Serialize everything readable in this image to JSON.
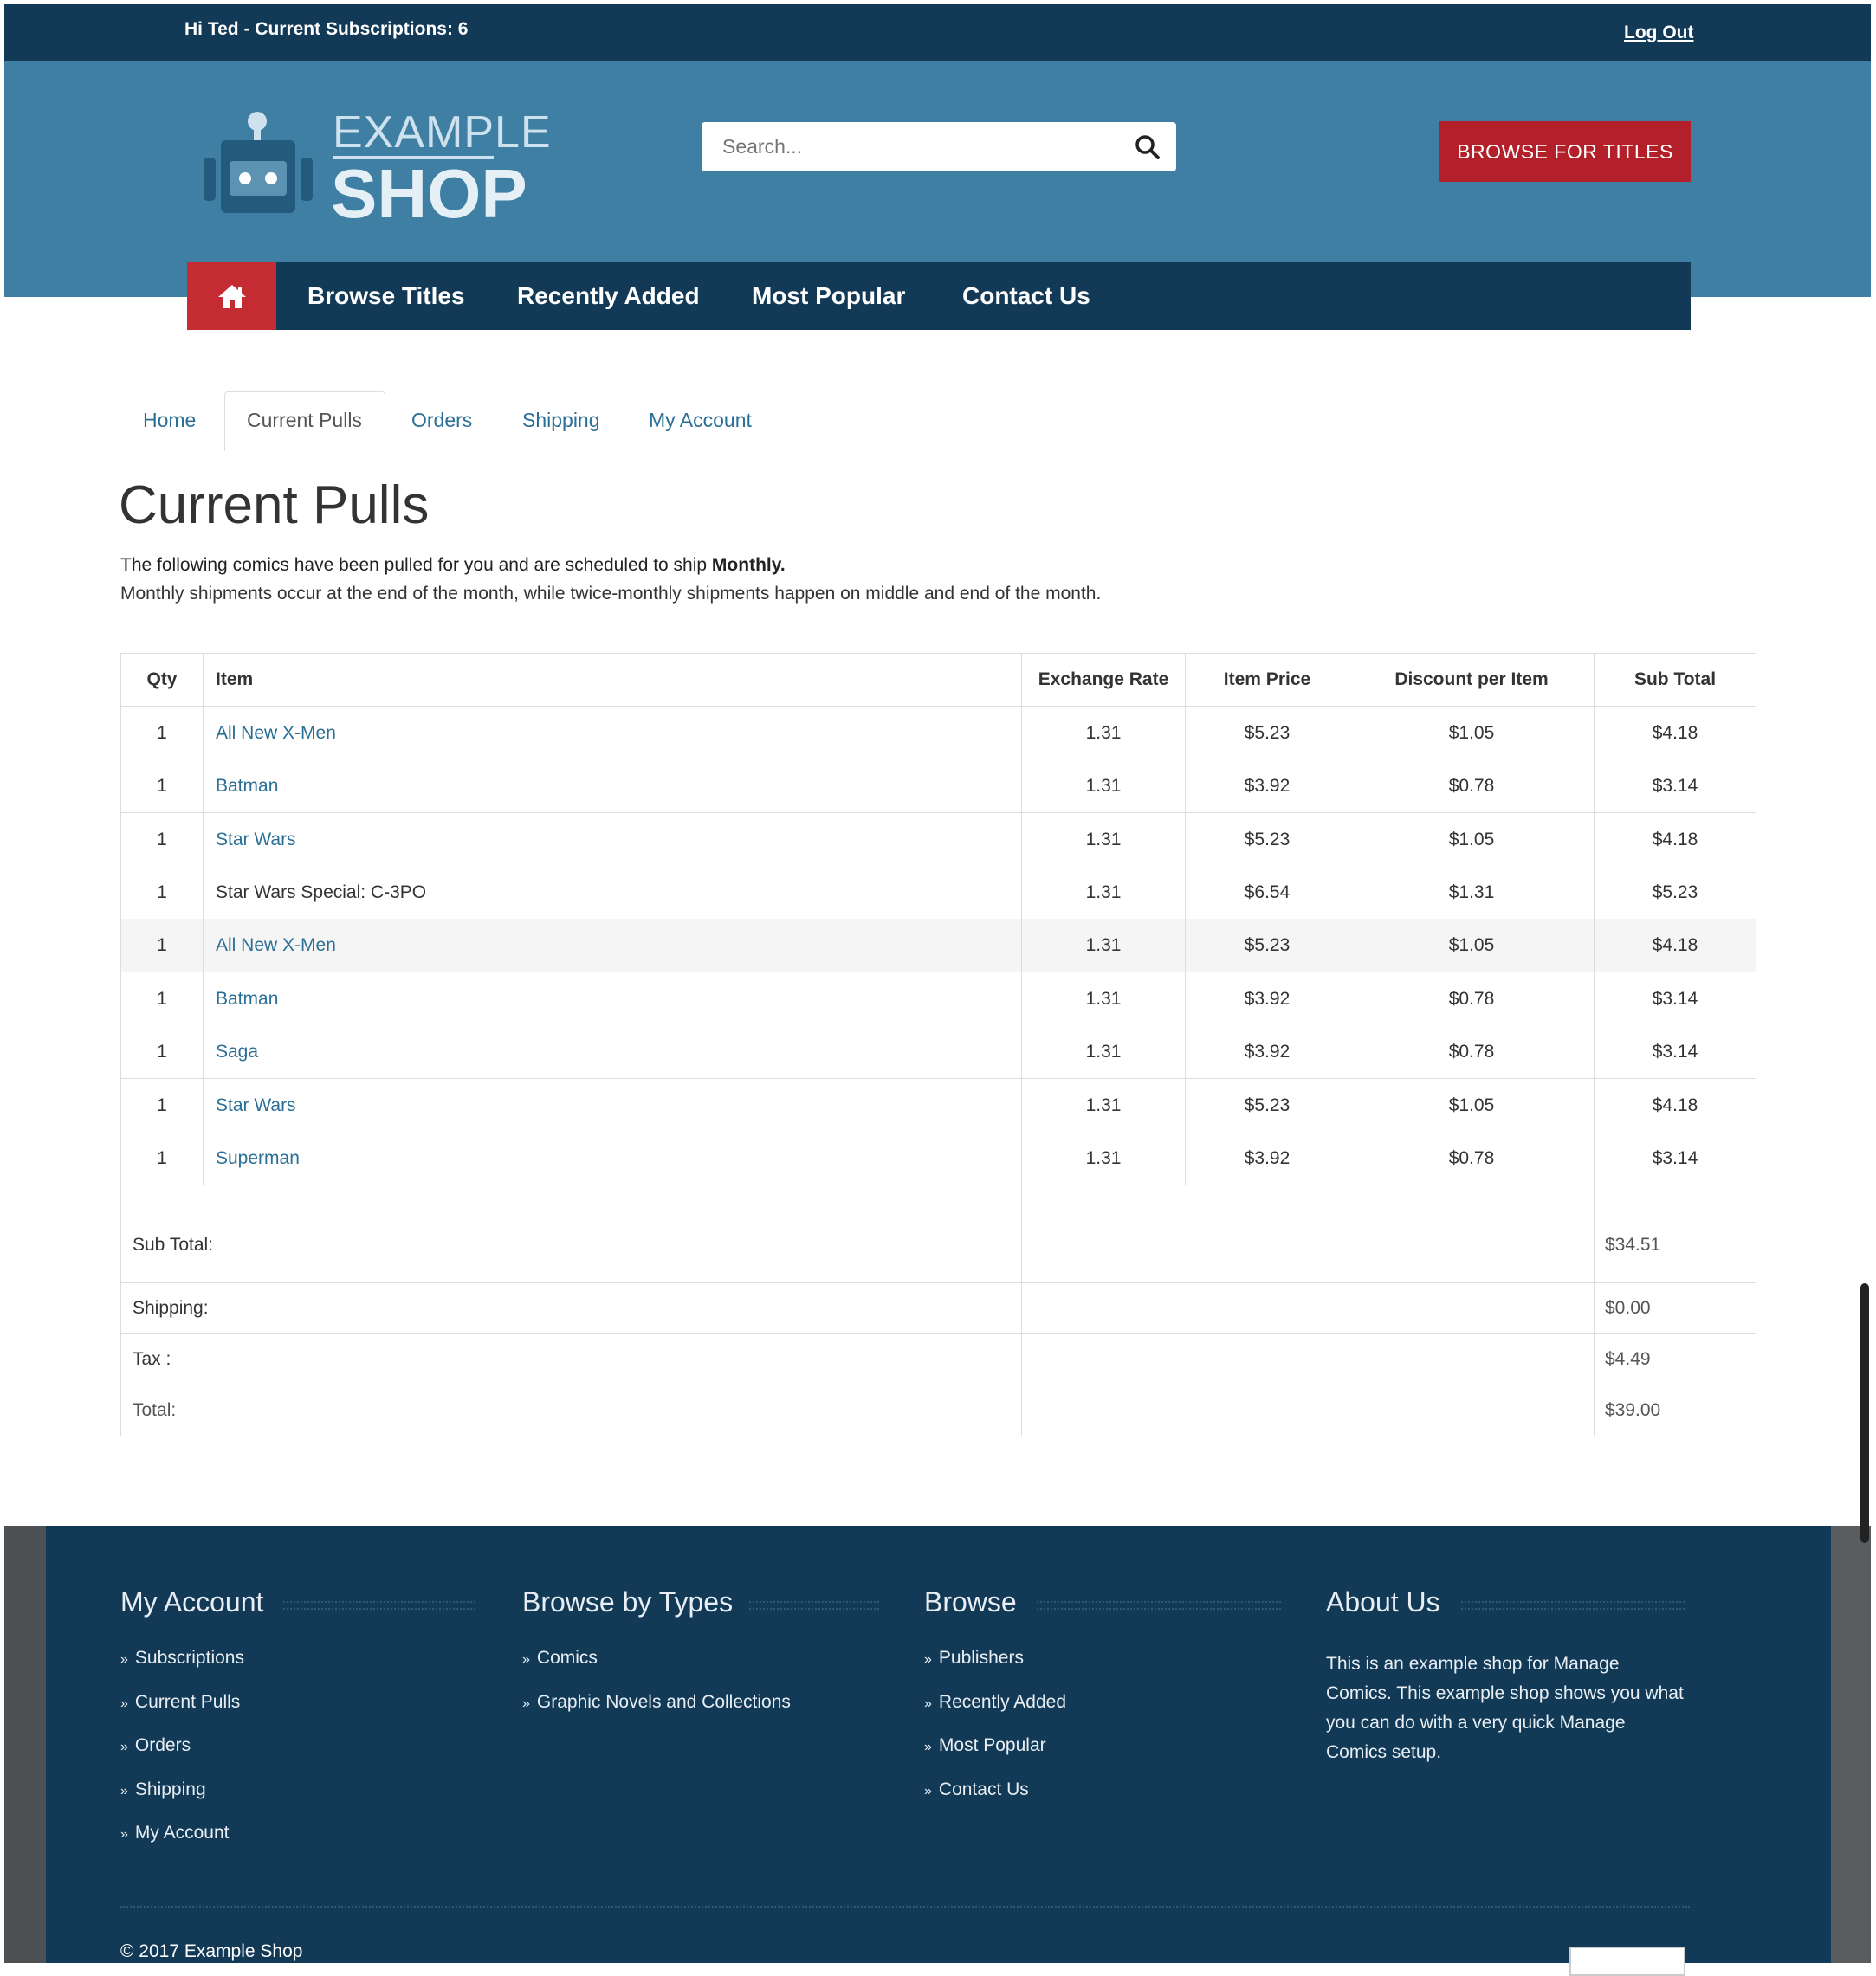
{
  "topbar": {
    "greeting": "Hi Ted - Current Subscriptions: 6",
    "logout": "Log Out"
  },
  "logo": {
    "line1": "EXAMPLE",
    "line2": "SHOP"
  },
  "search": {
    "placeholder": "Search..."
  },
  "browse_button": "BROWSE FOR TITLES",
  "nav": {
    "items": [
      "Browse Titles",
      "Recently Added",
      "Most Popular",
      "Contact Us"
    ]
  },
  "tabs": [
    "Home",
    "Current Pulls",
    "Orders",
    "Shipping",
    "My Account"
  ],
  "page": {
    "title": "Current Pulls",
    "intro_prefix": "The following comics have been pulled for you and are scheduled to ship ",
    "intro_frequency": "Monthly.",
    "intro2": "Monthly shipments occur at the end of the month, while twice-monthly shipments happen on middle and end of the month."
  },
  "table": {
    "headers": [
      "Qty",
      "Item",
      "Exchange Rate",
      "Item Price",
      "Discount per Item",
      "Sub Total"
    ],
    "rows": [
      {
        "qty": "1",
        "item": "All New X-Men",
        "rate": "1.31",
        "price": "$5.23",
        "discount": "$1.05",
        "subtotal": "$4.18"
      },
      {
        "qty": "1",
        "item": "Batman",
        "rate": "1.31",
        "price": "$3.92",
        "discount": "$0.78",
        "subtotal": "$3.14"
      },
      {
        "qty": "1",
        "item": "Star Wars",
        "rate": "1.31",
        "price": "$5.23",
        "discount": "$1.05",
        "subtotal": "$4.18"
      },
      {
        "qty": "1",
        "item": "Star Wars Special: C-3PO",
        "rate": "1.31",
        "price": "$6.54",
        "discount": "$1.31",
        "subtotal": "$5.23"
      },
      {
        "qty": "1",
        "item": "All New X-Men",
        "rate": "1.31",
        "price": "$5.23",
        "discount": "$1.05",
        "subtotal": "$4.18"
      },
      {
        "qty": "1",
        "item": "Batman",
        "rate": "1.31",
        "price": "$3.92",
        "discount": "$0.78",
        "subtotal": "$3.14"
      },
      {
        "qty": "1",
        "item": "Saga",
        "rate": "1.31",
        "price": "$3.92",
        "discount": "$0.78",
        "subtotal": "$3.14"
      },
      {
        "qty": "1",
        "item": "Star Wars",
        "rate": "1.31",
        "price": "$5.23",
        "discount": "$1.05",
        "subtotal": "$4.18"
      },
      {
        "qty": "1",
        "item": "Superman",
        "rate": "1.31",
        "price": "$3.92",
        "discount": "$0.78",
        "subtotal": "$3.14"
      }
    ],
    "totals": [
      {
        "label": "Sub Total:",
        "value": "$34.51"
      },
      {
        "label": "Shipping:",
        "value": "$0.00"
      },
      {
        "label": "Tax :",
        "value": "$4.49"
      },
      {
        "label": "Total:",
        "value": "$39.00"
      }
    ]
  },
  "footer": {
    "my_account": {
      "heading": "My Account",
      "links": [
        "Subscriptions",
        "Current Pulls",
        "Orders",
        "Shipping",
        "My Account"
      ]
    },
    "browse_types": {
      "heading": "Browse by Types",
      "links": [
        "Comics",
        "Graphic Novels and Collections"
      ]
    },
    "browse": {
      "heading": "Browse",
      "links": [
        "Publishers",
        "Recently Added",
        "Most Popular",
        "Contact Us"
      ]
    },
    "about": {
      "heading": "About Us",
      "text": "This is an example shop for Manage Comics. This example shop shows you what you can do with a very quick Manage Comics setup."
    },
    "copyright": "© 2017 Example Shop"
  },
  "colors": {
    "topbar": "#123a57",
    "header": "#3e7fa3",
    "accent_red": "#b3202a",
    "link": "#2a6f96"
  }
}
